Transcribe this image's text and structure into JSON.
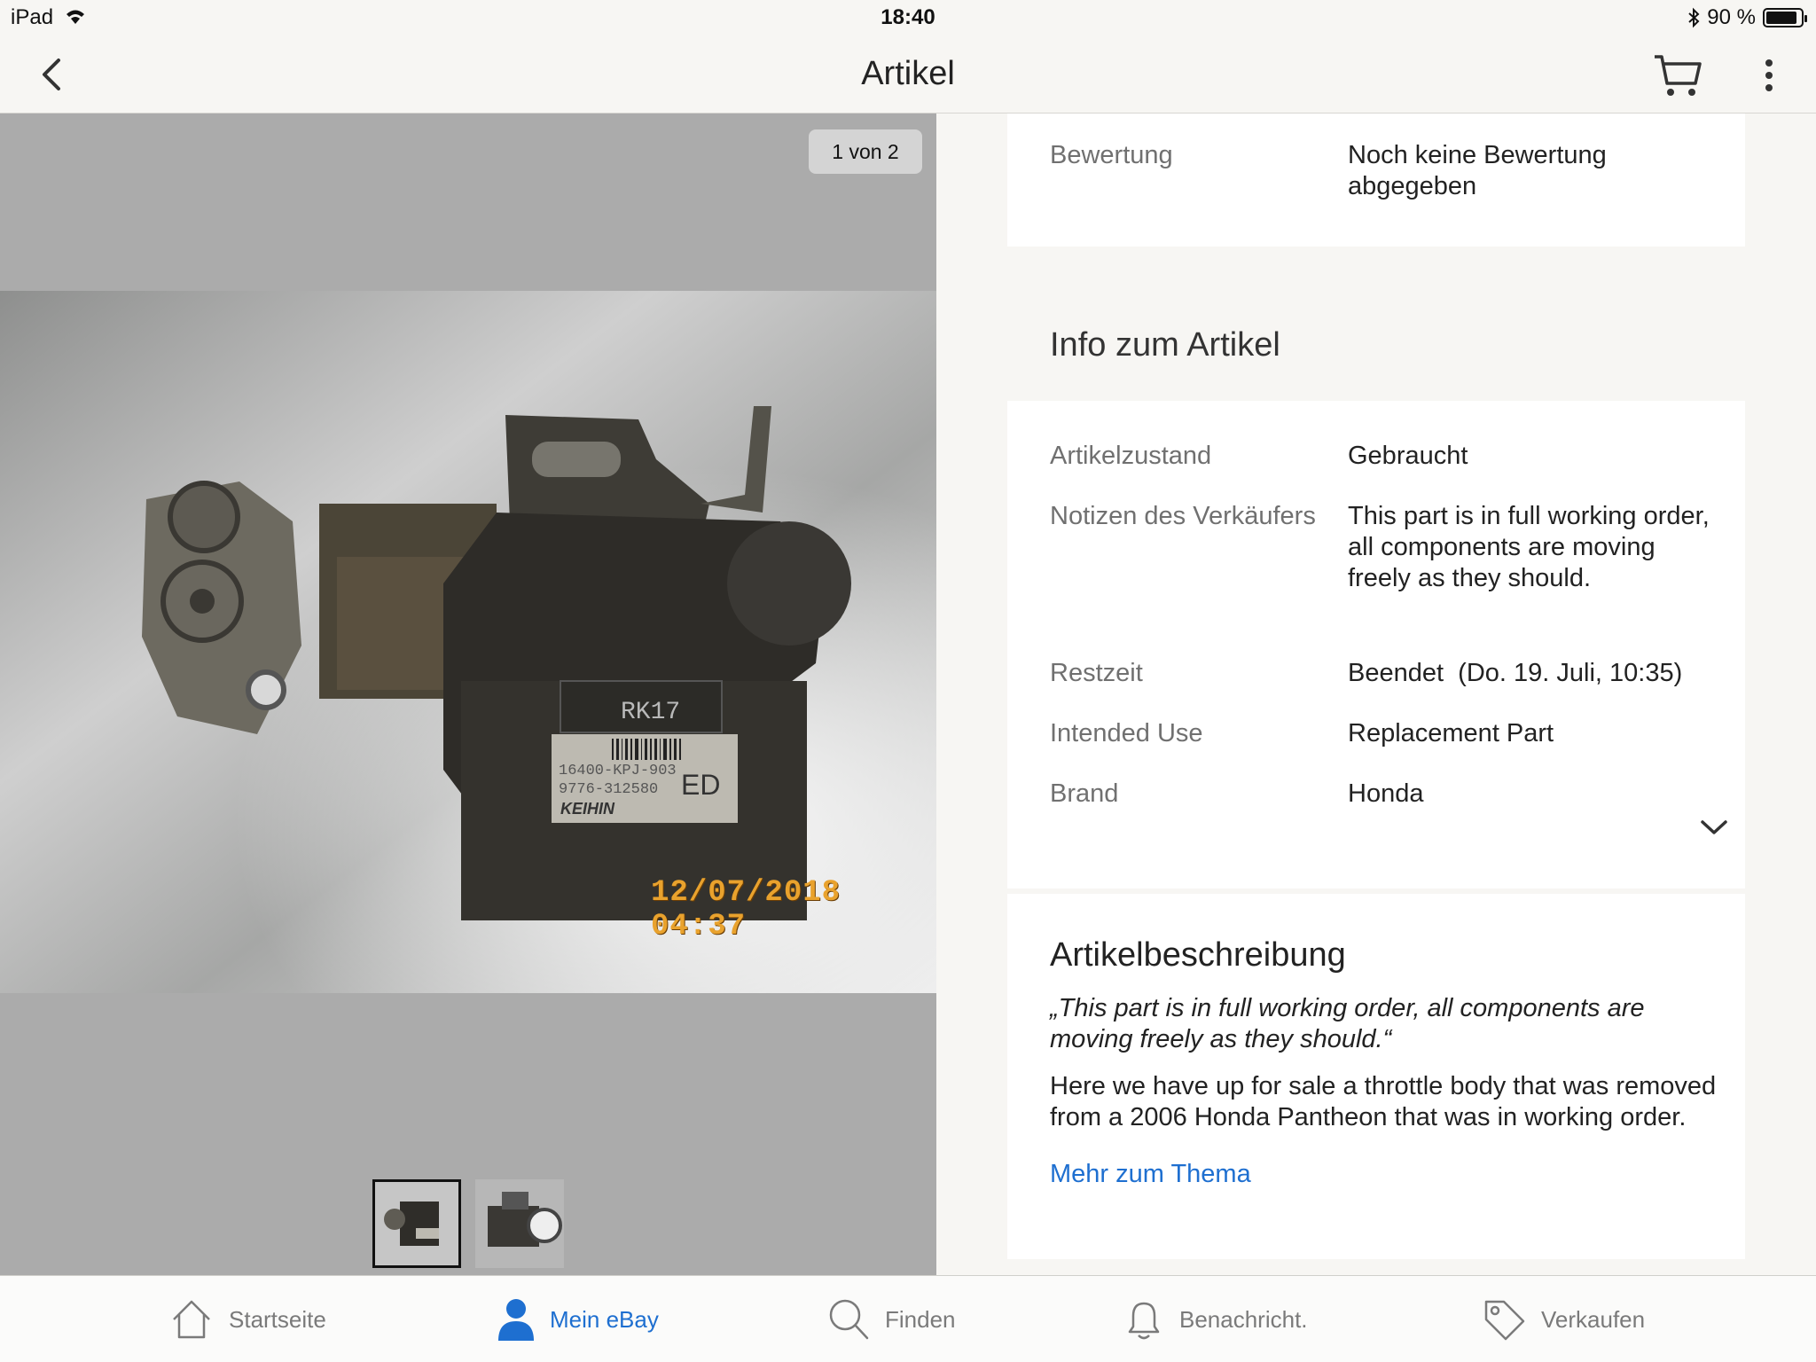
{
  "status": {
    "device": "iPad",
    "time": "18:40",
    "battery": "90 %",
    "battery_level": 0.9
  },
  "nav": {
    "title": "Artikel",
    "back_icon": "chevron-left-icon",
    "cart_icon": "cart-icon",
    "more_icon": "more-vertical-icon"
  },
  "gallery": {
    "counter": "1 von 2",
    "photo_timestamp": "12/07/2018 04:37",
    "label_rk": "RK17",
    "label_part": "16400-KPJ-903",
    "label_num": "9776-312580",
    "label_brand": "KEIHIN",
    "label_code": "ED",
    "thumbnail_count": 2,
    "selected_thumbnail": 1
  },
  "rating": {
    "label": "Bewertung",
    "value": "Noch keine Bewertung abgegeben"
  },
  "info": {
    "title": "Info zum Artikel",
    "rows": [
      {
        "label": "Artikelzustand",
        "value": "Gebraucht"
      },
      {
        "label": "Notizen des Verkäufers",
        "value": "This part is in full working order, all components are moving freely as they should."
      },
      {
        "label": "Restzeit",
        "value": "Beendet  (Do. 19. Juli, 10:35)"
      },
      {
        "label": "Intended Use",
        "value": "Replacement Part"
      },
      {
        "label": "Brand",
        "value": "Honda"
      }
    ]
  },
  "description": {
    "title": "Artikelbeschreibung",
    "quote": "„This part is in full working order, all components are moving freely as they should.“",
    "body": "Here we have up for sale a throttle body that was removed from a 2006 Honda Pantheon that was in working order.",
    "link": "Mehr zum Thema"
  },
  "tabs": [
    {
      "label": "Startseite",
      "icon": "home-icon",
      "active": false
    },
    {
      "label": "Mein eBay",
      "icon": "person-icon",
      "active": true
    },
    {
      "label": "Finden",
      "icon": "search-icon",
      "active": false
    },
    {
      "label": "Benachricht.",
      "icon": "bell-icon",
      "active": false
    },
    {
      "label": "Verkaufen",
      "icon": "tag-icon",
      "active": false
    }
  ],
  "colors": {
    "accent": "#1e6fd0",
    "gallery_bg": "#ababab",
    "page_bg": "#f7f6f3",
    "stamp": "#e9a22d"
  }
}
